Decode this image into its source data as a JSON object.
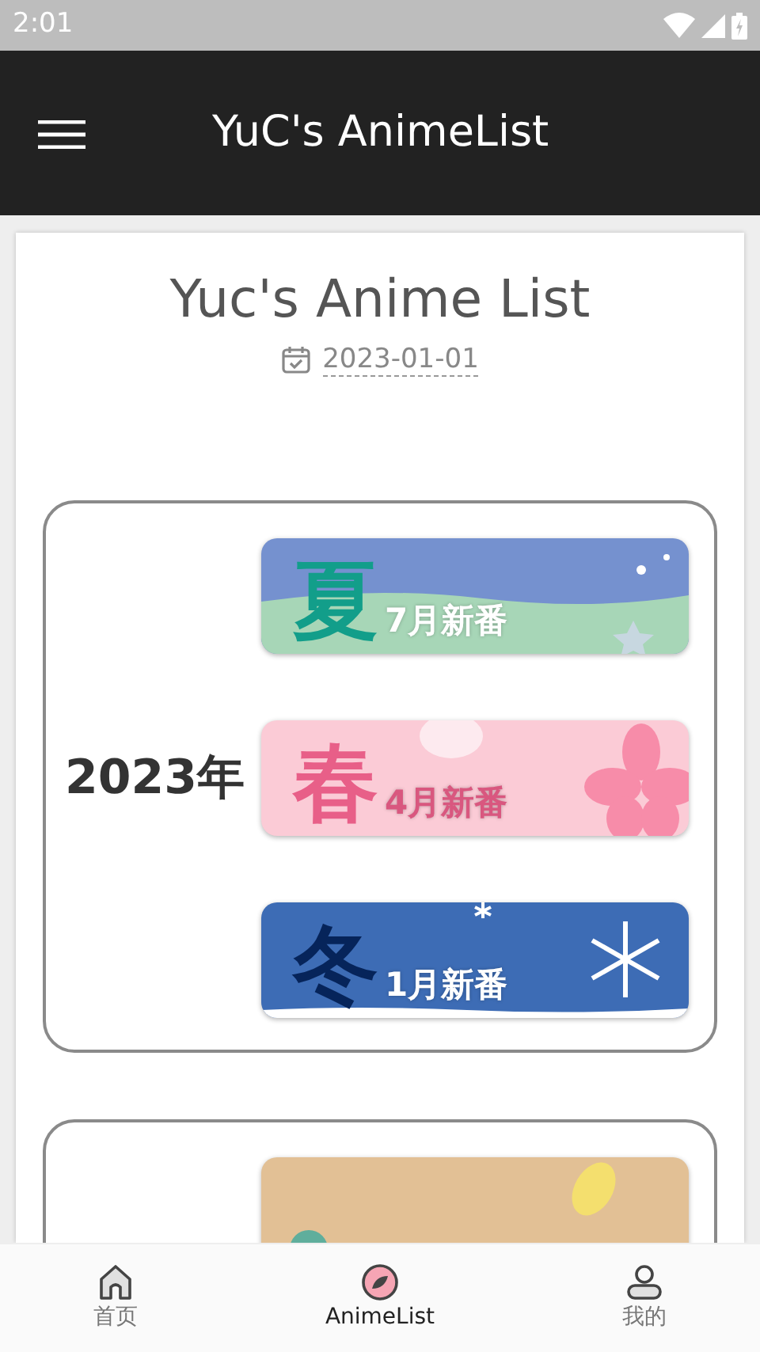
{
  "status_bar": {
    "time": "2:01"
  },
  "app_bar": {
    "title": "YuC's AnimeList"
  },
  "page": {
    "title": "Yuc's Anime List",
    "date": "2023-01-01"
  },
  "years": [
    {
      "year": "2023年",
      "banners": [
        {
          "kind": "summer",
          "character": "夏",
          "label": "7月新番"
        },
        {
          "kind": "spring",
          "character": "春",
          "label": "4月新番"
        },
        {
          "kind": "winter",
          "character": "冬",
          "label": "1月新番"
        }
      ]
    },
    {
      "banners": [
        {
          "kind": "autumn"
        }
      ]
    }
  ],
  "bottom_nav": [
    {
      "kind": "home",
      "label": "首页",
      "selected": false
    },
    {
      "kind": "list",
      "label": "AnimeList",
      "selected": true
    },
    {
      "kind": "profile",
      "label": "我的",
      "selected": false
    }
  ]
}
